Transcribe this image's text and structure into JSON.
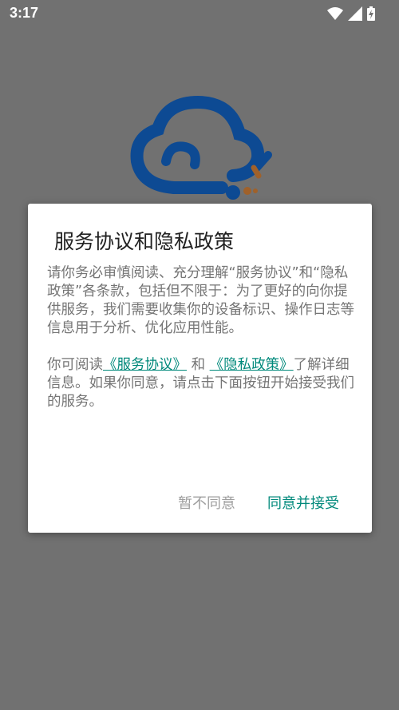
{
  "status_bar": {
    "time": "3:17"
  },
  "dialog": {
    "title": "服务协议和隐私政策",
    "paragraph1": "请你务必审慎阅读、充分理解“服务协议”和“隐私政策”各条款，包括但不限于：为了更好的向你提供服务，我们需要收集你的设备标识、操作日志等信息用于分析、优化应用性能。",
    "p2_prefix": "你可阅读",
    "link_service": "《服务协议》",
    "p2_and": "和",
    "link_privacy": "《隐私政策》",
    "p2_suffix": "了解详细信息。如果你同意，请点击下面按钮开始接受我们的服务。",
    "decline_label": "暂不同意",
    "accept_label": "同意并接受"
  },
  "colors": {
    "accent": "#00897b",
    "logo_blue": "#0d4a93",
    "logo_brown": "#a0612a",
    "scrim": "#717171"
  }
}
